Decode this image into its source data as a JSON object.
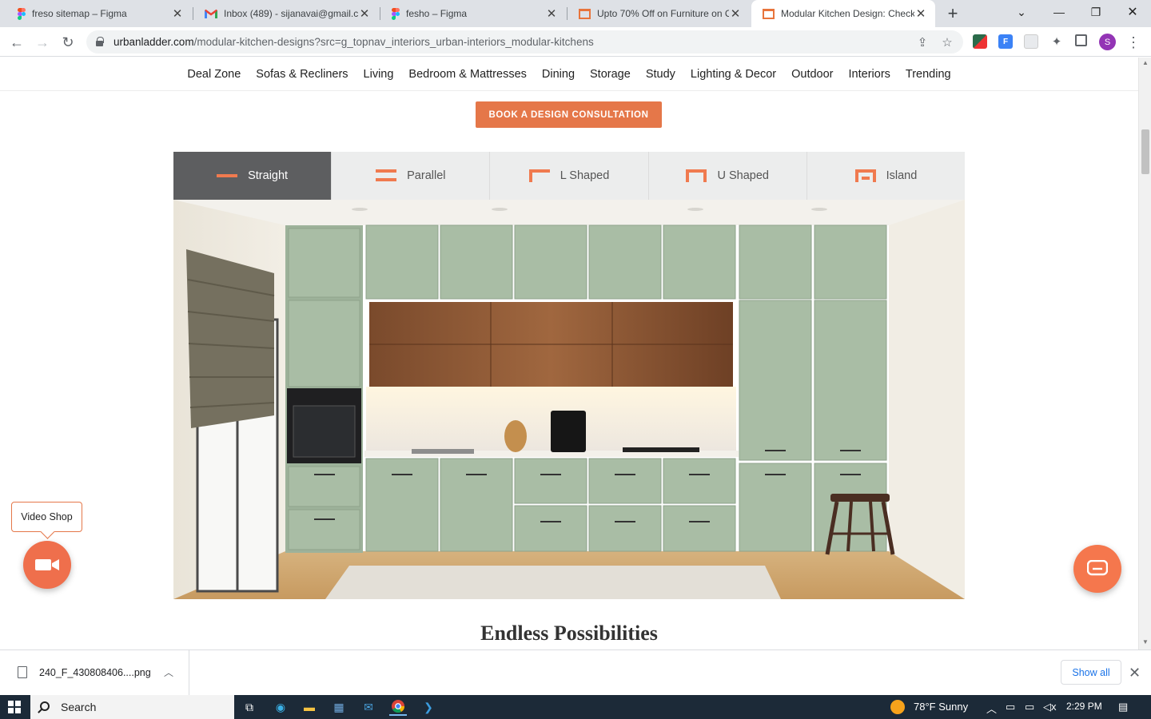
{
  "browser": {
    "tabs": [
      {
        "title": "freso sitemap – Figma",
        "favicon": "figma-icon"
      },
      {
        "title": "Inbox (489) - sijanavai@gmail.co",
        "favicon": "gmail-icon"
      },
      {
        "title": "fesho – Figma",
        "favicon": "figma-icon"
      },
      {
        "title": "Upto 70% Off on Furniture on C",
        "favicon": "urbanladder-icon"
      },
      {
        "title": "Modular Kitchen Design: Check",
        "favicon": "urbanladder-icon",
        "active": true
      }
    ],
    "new_tab": "+",
    "url_host": "urbanladder.com",
    "url_path": "/modular-kitchen-designs?src=g_topnav_interiors_urban-interiors_modular-kitchens",
    "profile_initial": "S"
  },
  "site": {
    "nav": [
      "Deal Zone",
      "Sofas & Recliners",
      "Living",
      "Bedroom & Mattresses",
      "Dining",
      "Storage",
      "Study",
      "Lighting & Decor",
      "Outdoor",
      "Interiors",
      "Trending"
    ],
    "cta": "BOOK A DESIGN CONSULTATION",
    "layout_tabs": [
      {
        "label": "Straight",
        "icon": "straight-layout-icon",
        "active": true
      },
      {
        "label": "Parallel",
        "icon": "parallel-layout-icon"
      },
      {
        "label": "L Shaped",
        "icon": "l-shaped-layout-icon"
      },
      {
        "label": "U Shaped",
        "icon": "u-shaped-layout-icon"
      },
      {
        "label": "Island",
        "icon": "island-layout-icon"
      }
    ],
    "section_title": "Endless Possibilities",
    "video_shop_label": "Video Shop"
  },
  "downloads": {
    "file_name": "240_F_430808406....png",
    "show_all": "Show all"
  },
  "taskbar": {
    "search_label": "Search",
    "weather": "78°F  Sunny",
    "time": "2:29 PM"
  },
  "colors": {
    "accent": "#e57749",
    "active_tab_bg": "#5d5e60",
    "cabinet_green": "#9db29a"
  }
}
